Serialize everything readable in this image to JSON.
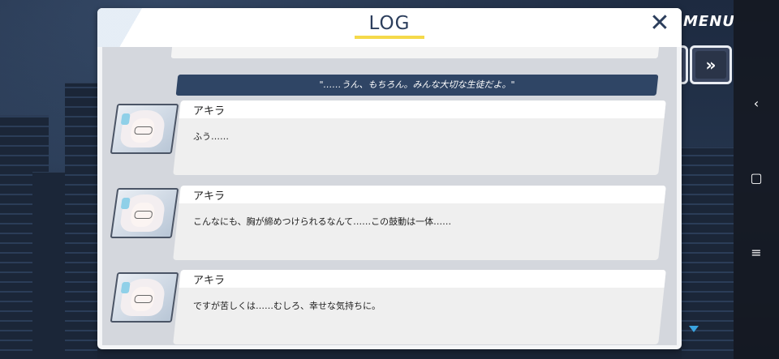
{
  "window": {
    "title": "LOG",
    "close_label": "✕"
  },
  "hud": {
    "menu_label": "MENU",
    "fast_forward_label": "»"
  },
  "player_line": "\"……うん、もちろん。みんな大切な生徒だよ。\"",
  "entries": [
    {
      "speaker": "アキラ",
      "text": "ふう……"
    },
    {
      "speaker": "アキラ",
      "text": "こんなにも、胸が締めつけられるなんて……この鼓動は一体……"
    },
    {
      "speaker": "アキラ",
      "text": "ですが苦しくは……むしろ、幸せな気持ちに。"
    }
  ],
  "system_nav": {
    "back": "‹",
    "home": "▢",
    "recents": "≡"
  },
  "colors": {
    "accent": "#f5d94a",
    "title": "#2c3e5c",
    "player_line_bg": "#2f4565"
  }
}
